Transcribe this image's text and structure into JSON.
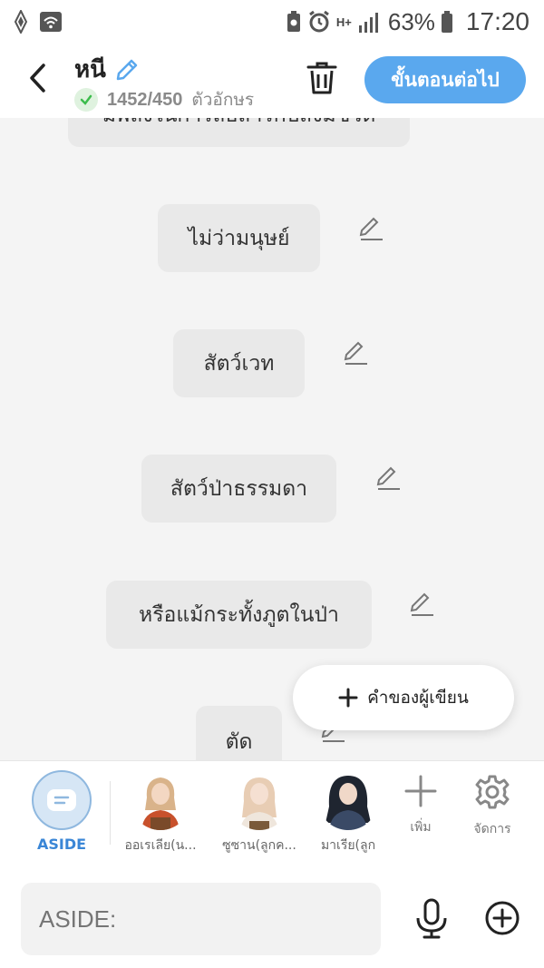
{
  "status_bar": {
    "battery_percent": "63%",
    "time": "17:20",
    "network": "H+"
  },
  "header": {
    "title": "หนี",
    "count_text": "1452/450",
    "count_suffix": "ตัวอักษร",
    "next_label": "ขั้นตอนต่อไป",
    "accent": "#5aa8ee"
  },
  "messages": [
    {
      "text": "มีพลังในการสื่อสารกับสิ่งมีชีวิต"
    },
    {
      "text": "ไม่ว่ามนุษย์"
    },
    {
      "text": "สัตว์เวท"
    },
    {
      "text": "สัตว์ป่าธรรมดา"
    },
    {
      "text": "หรือแม้กระทั้งภูตในป่า"
    },
    {
      "text": "ตัด"
    }
  ],
  "writer_button": {
    "label": "คำของผู้เขียน"
  },
  "characters": [
    {
      "label": "ASIDE"
    },
    {
      "label": "ออเรเลีย(น..."
    },
    {
      "label": "ซูซาน(ลูกค..."
    },
    {
      "label": "มาเรีย(ลูก"
    }
  ],
  "tools": {
    "add_label": "เพิ่ม",
    "manage_label": "จัดการ"
  },
  "input": {
    "placeholder": "ASIDE:"
  }
}
